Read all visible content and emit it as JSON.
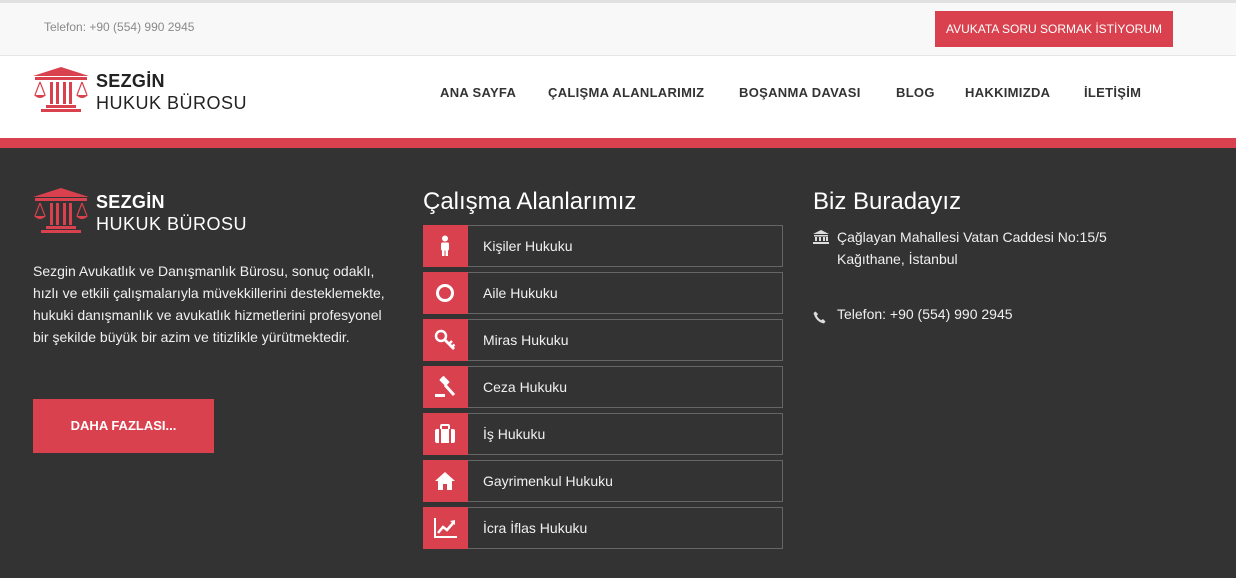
{
  "topbar": {
    "phone": "Telefon: +90 (554) 990 2945",
    "ask_button": "AVUKATA SORU SORMAK İSTİYORUM"
  },
  "brand": {
    "line1": "SEZGİN",
    "line2": "HUKUK BÜROSU",
    "logo_icon": "courthouse-scales-icon"
  },
  "nav": [
    "ANA SAYFA",
    "ÇALIŞMA ALANLARIMIZ",
    "BOŞANMA DAVASI",
    "BLOG",
    "HAKKIMIZDA",
    "İLETİŞİM"
  ],
  "footer": {
    "about_text": "Sezgin Avukatlık ve Danışmanlık Bürosu, sonuç odaklı, hızlı ve etkili çalışmalarıyla müvekkillerini desteklemekte, hukuki danışmanlık ve avukatlık hizmetlerini profesyonel bir şekilde büyük bir azim ve titizlikle yürütmektedir.",
    "more_button": "DAHA FAZLASI...",
    "areas_title": "Çalışma Alanlarımız",
    "areas": [
      {
        "label": "Kişiler Hukuku",
        "icon": "person-icon"
      },
      {
        "label": "Aile Hukuku",
        "icon": "ring-icon"
      },
      {
        "label": "Miras Hukuku",
        "icon": "key-icon"
      },
      {
        "label": "Ceza Hukuku",
        "icon": "gavel-icon"
      },
      {
        "label": "İş Hukuku",
        "icon": "briefcase-icon"
      },
      {
        "label": "Gayrimenkul Hukuku",
        "icon": "home-icon"
      },
      {
        "label": "İcra İflas Hukuku",
        "icon": "chart-icon"
      }
    ],
    "location_title": "Biz Buradayız",
    "address_line1": "Çağlayan Mahallesi Vatan Caddesi No:15/5",
    "address_line2": "Kağıthane, İstanbul",
    "phone": "Telefon: +90 (554) 990 2945"
  },
  "colors": {
    "accent": "#d9414e",
    "footer_bg": "#333333",
    "topbar_bg": "#f8f8f8"
  }
}
